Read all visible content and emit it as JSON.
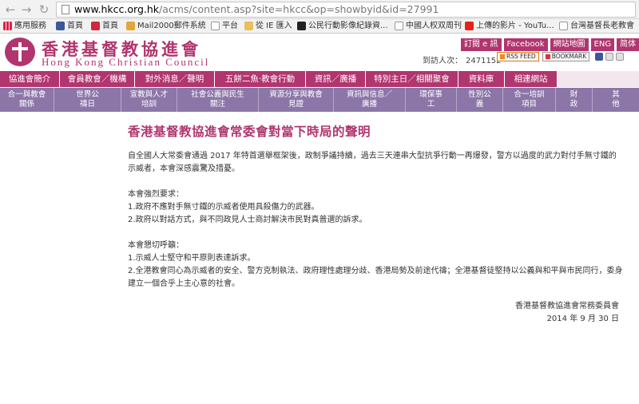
{
  "browser": {
    "url_host": "www.hkcc.org.hk",
    "url_path": "/acms/content.asp?site=hkcc&op=showbyid&id=27991",
    "bookmarks": [
      {
        "label": "應用服務",
        "icon": "apps-grid-icon"
      },
      {
        "label": "首頁",
        "icon": "facebook-icon"
      },
      {
        "label": "首頁",
        "icon": "red-circle-icon"
      },
      {
        "label": "Mail2000郵件系統",
        "icon": "mail-icon"
      },
      {
        "label": "平台",
        "icon": "page-icon"
      },
      {
        "label": "從 IE 匯入",
        "icon": "folder-icon"
      },
      {
        "label": "公民行動影像紀錄資...",
        "icon": "dark-circle-icon"
      },
      {
        "label": "中國人权双周刊",
        "icon": "page-icon"
      },
      {
        "label": "上傳的影片 - YouTu...",
        "icon": "youtube-icon"
      },
      {
        "label": "台灣基督長老教會",
        "icon": "page-icon"
      }
    ]
  },
  "site": {
    "name_zh": "香港基督教協進會",
    "name_en": "Hong Kong Christian Council",
    "top_links": [
      "訂閱 e 訊",
      "Facebook",
      "網站地圖",
      "ENG",
      "简体"
    ],
    "visitor_label": "到訪人次：",
    "visitor_count": "2471152",
    "feed_badges": {
      "rss": "RSS FEED",
      "bookmark": "BOOKMARK"
    },
    "colors": {
      "brand": "#b1356e",
      "nav2": "#8c76a8",
      "nav1_bg": "#f3e7ee"
    }
  },
  "nav_primary": [
    "協進會簡介",
    "會員教會／機構",
    "對外消息／聲明",
    "五餅二魚‧教會行動",
    "資訊／廣播",
    "特別主日／相關聚會",
    "資料庫",
    "相連網站"
  ],
  "nav_secondary": [
    [
      "合一與教會",
      "關係"
    ],
    [
      "世界公",
      "禱日"
    ],
    [
      "宣教與人才",
      "培訓"
    ],
    [
      "社會公義與民生",
      "關注"
    ],
    [
      "資源分享與教會",
      "見證"
    ],
    [
      "資訊與信息／",
      "廣播"
    ],
    [
      "環保事",
      "工"
    ],
    [
      "性別公",
      "義"
    ],
    [
      "合一培訓",
      "項目"
    ],
    [
      "財",
      "政"
    ],
    [
      "其",
      "他"
    ]
  ],
  "article": {
    "title": "香港基督教協進會常委會對當下時局的聲明",
    "intro": "自全國人大常委會通過 2017 年特首選舉框架後，政制爭議持續，過去三天連串大型抗爭行動一再爆發，警方以過度的武力對付手無寸鐵的示威者，本會深感震驚及措憂。",
    "demands_heading": "本會強烈要求：",
    "demands": [
      "1.政府不應對手無寸鐵的示威者使用具殺傷力的武器。",
      "2.政府以對話方式，與不同政見人士商討解決市民對真普選的訴求。"
    ],
    "appeals_heading": "本會懇切呼籲：",
    "appeals": [
      "1.示威人士堅守和平原則表達訴求。",
      "2.全港教會同心為示威者的安全、警方克制執法、政府理性處理分歧、香港局勢及前途代禱；全港基督徒堅持以公義與和平與市民同行，委身建立一個合乎上主心意的社會。"
    ],
    "signature": "香港基督教協進會常務委員會",
    "date": "2014 年 9 月 30 日"
  }
}
